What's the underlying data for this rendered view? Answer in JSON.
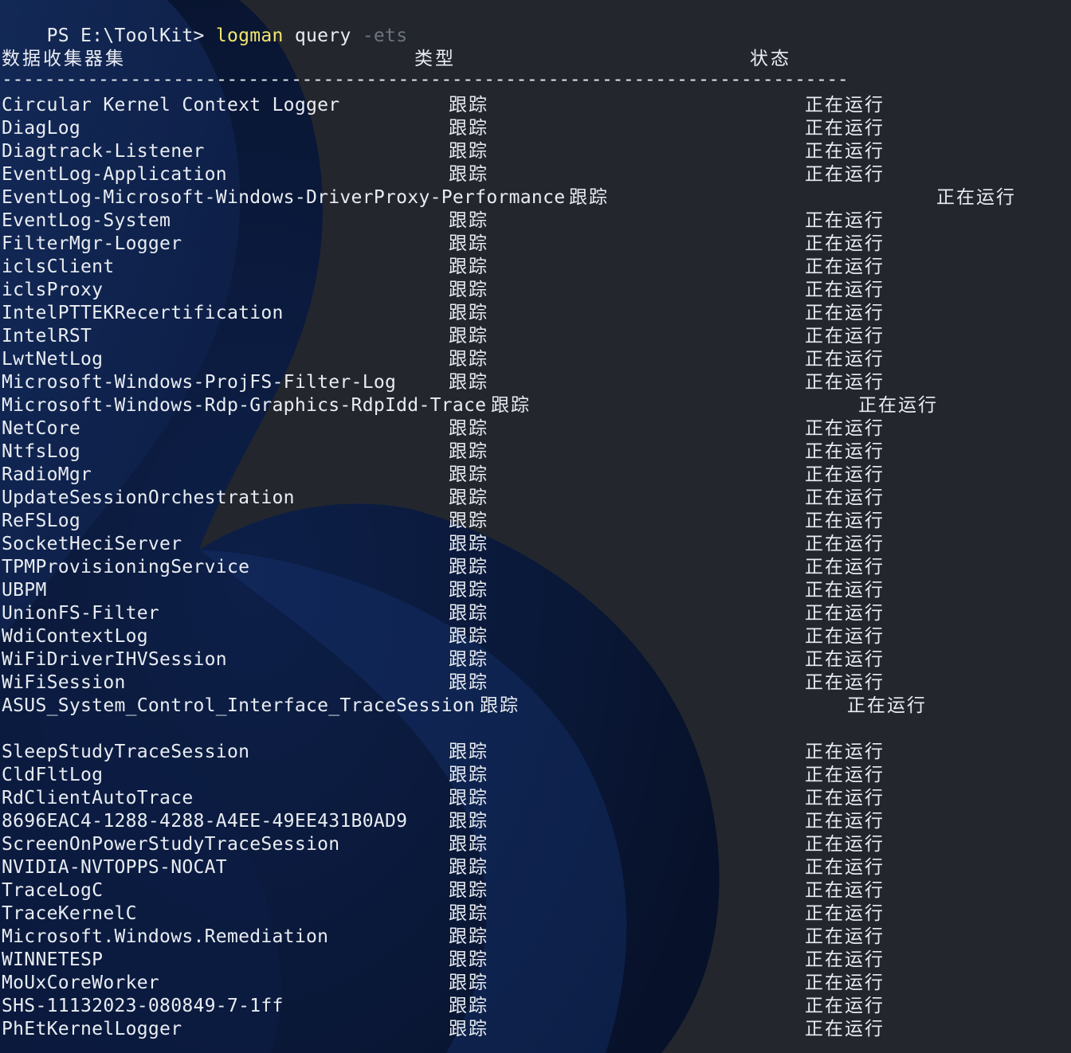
{
  "terminal": {
    "prompt": "PS E:\\ToolKit> ",
    "command": "logman",
    "argument": "query",
    "parameter": "-ets",
    "headers": {
      "name": "数据收集器集",
      "type": "类型",
      "status": "状态"
    },
    "separator": "-------------------------------------------------------------------------------",
    "rows": [
      {
        "name": "Circular Kernel Context Logger",
        "type": "跟踪",
        "status": "正在运行"
      },
      {
        "name": "DiagLog",
        "type": "跟踪",
        "status": "正在运行"
      },
      {
        "name": "Diagtrack-Listener",
        "type": "跟踪",
        "status": "正在运行"
      },
      {
        "name": "EventLog-Application",
        "type": "跟踪",
        "status": "正在运行"
      },
      {
        "name": "EventLog-Microsoft-Windows-DriverProxy-Performance",
        "type": "跟踪",
        "status": "正在运行",
        "overflow": true
      },
      {
        "name": "EventLog-System",
        "type": "跟踪",
        "status": "正在运行"
      },
      {
        "name": "FilterMgr-Logger",
        "type": "跟踪",
        "status": "正在运行"
      },
      {
        "name": "iclsClient",
        "type": "跟踪",
        "status": "正在运行"
      },
      {
        "name": "iclsProxy",
        "type": "跟踪",
        "status": "正在运行"
      },
      {
        "name": "IntelPTTEKRecertification",
        "type": "跟踪",
        "status": "正在运行"
      },
      {
        "name": "IntelRST",
        "type": "跟踪",
        "status": "正在运行"
      },
      {
        "name": "LwtNetLog",
        "type": "跟踪",
        "status": "正在运行"
      },
      {
        "name": "Microsoft-Windows-ProjFS-Filter-Log",
        "type": "跟踪",
        "status": "正在运行"
      },
      {
        "name": "Microsoft-Windows-Rdp-Graphics-RdpIdd-Trace",
        "type": "跟踪",
        "status": "正在运行",
        "overflow": true
      },
      {
        "name": "NetCore",
        "type": "跟踪",
        "status": "正在运行"
      },
      {
        "name": "NtfsLog",
        "type": "跟踪",
        "status": "正在运行"
      },
      {
        "name": "RadioMgr",
        "type": "跟踪",
        "status": "正在运行"
      },
      {
        "name": "UpdateSessionOrchestration",
        "type": "跟踪",
        "status": "正在运行"
      },
      {
        "name": "ReFSLog",
        "type": "跟踪",
        "status": "正在运行"
      },
      {
        "name": "SocketHeciServer",
        "type": "跟踪",
        "status": "正在运行"
      },
      {
        "name": "TPMProvisioningService",
        "type": "跟踪",
        "status": "正在运行"
      },
      {
        "name": "UBPM",
        "type": "跟踪",
        "status": "正在运行"
      },
      {
        "name": "UnionFS-Filter",
        "type": "跟踪",
        "status": "正在运行"
      },
      {
        "name": "WdiContextLog",
        "type": "跟踪",
        "status": "正在运行"
      },
      {
        "name": "WiFiDriverIHVSession",
        "type": "跟踪",
        "status": "正在运行"
      },
      {
        "name": "WiFiSession",
        "type": "跟踪",
        "status": "正在运行"
      },
      {
        "name": "ASUS_System_Control_Interface_TraceSession",
        "type": "跟踪",
        "status": "正在运行",
        "overflow": true
      },
      {
        "name": "",
        "type": "",
        "status": ""
      },
      {
        "name": "SleepStudyTraceSession",
        "type": "跟踪",
        "status": "正在运行"
      },
      {
        "name": "CldFltLog",
        "type": "跟踪",
        "status": "正在运行"
      },
      {
        "name": "RdClientAutoTrace",
        "type": "跟踪",
        "status": "正在运行"
      },
      {
        "name": "8696EAC4-1288-4288-A4EE-49EE431B0AD9",
        "type": "跟踪",
        "status": "正在运行"
      },
      {
        "name": "ScreenOnPowerStudyTraceSession",
        "type": "跟踪",
        "status": "正在运行"
      },
      {
        "name": "NVIDIA-NVTOPPS-NOCAT",
        "type": "跟踪",
        "status": "正在运行"
      },
      {
        "name": "TraceLogC",
        "type": "跟踪",
        "status": "正在运行"
      },
      {
        "name": "TraceKernelC",
        "type": "跟踪",
        "status": "正在运行"
      },
      {
        "name": "Microsoft.Windows.Remediation",
        "type": "跟踪",
        "status": "正在运行"
      },
      {
        "name": "WINNETESP",
        "type": "跟踪",
        "status": "正在运行"
      },
      {
        "name": "MoUxCoreWorker",
        "type": "跟踪",
        "status": "正在运行"
      },
      {
        "name": "SHS-11132023-080849-7-1ff",
        "type": "跟踪",
        "status": "正在运行"
      },
      {
        "name": "PhEtKernelLogger",
        "type": "跟踪",
        "status": "正在运行"
      }
    ]
  },
  "colors": {
    "background": "#23272d",
    "text": "#e9edf2",
    "command": "#f2e56b",
    "parameter": "#6c7480",
    "wallpaper_bloom": "#0f2550"
  }
}
